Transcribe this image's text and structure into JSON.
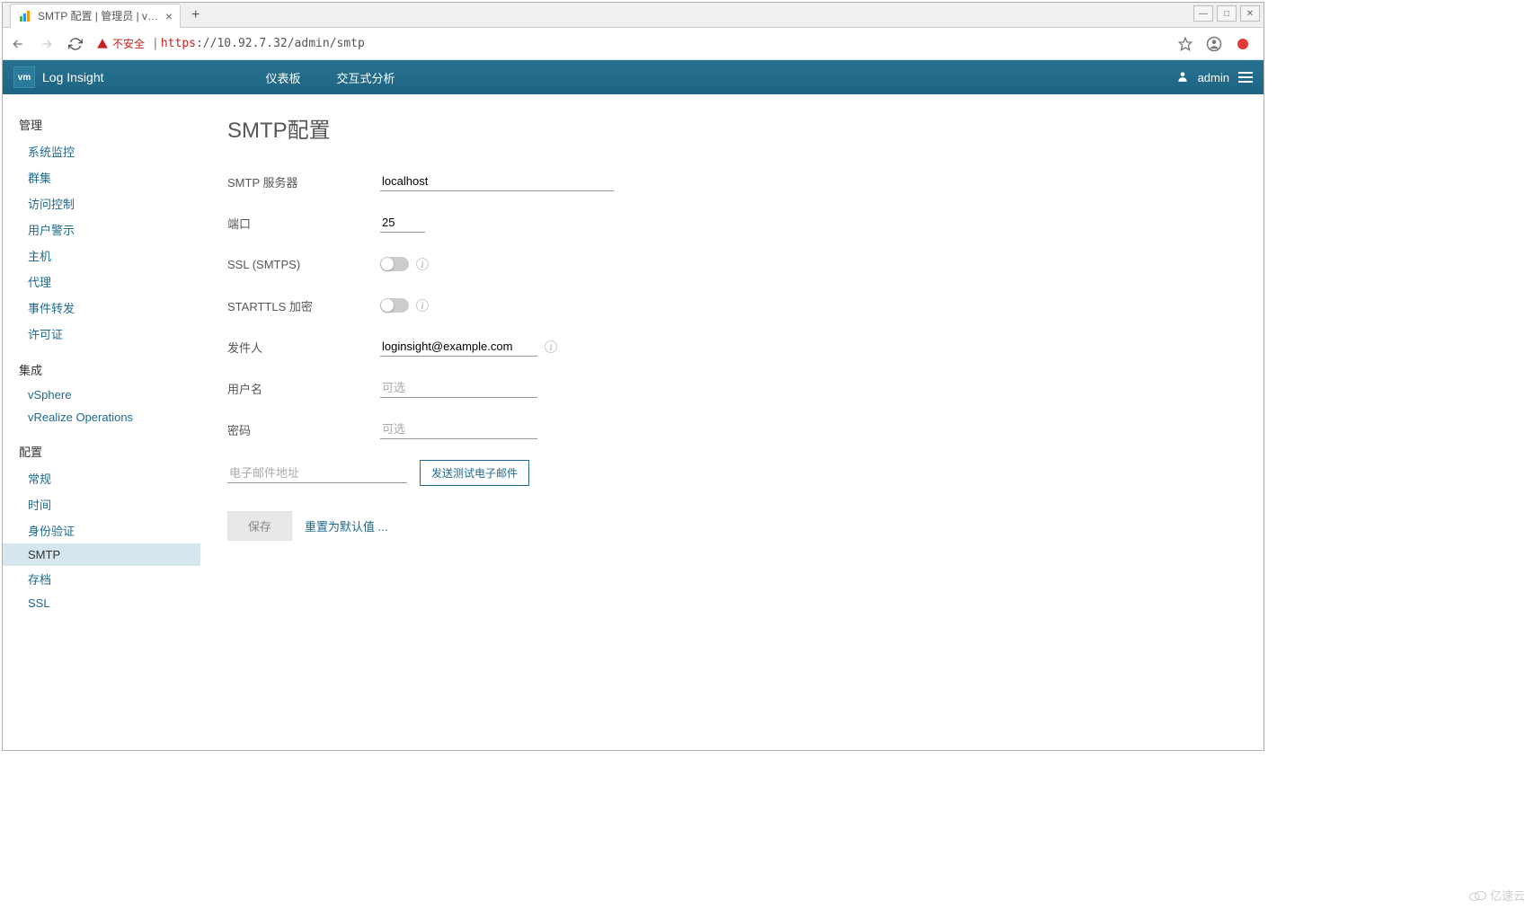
{
  "window": {
    "tab_title": "SMTP 配置 | 管理员 | vRealize",
    "minimize": "—",
    "maximize": "□",
    "close": "✕"
  },
  "browser": {
    "insecure_label": "不安全",
    "url_scheme": "https",
    "url_rest": "://10.92.7.32/admin/smtp"
  },
  "header": {
    "logo": "vm",
    "brand": "Log Insight",
    "nav_dashboard": "仪表板",
    "nav_interactive": "交互式分析",
    "user": "admin"
  },
  "sidebar": {
    "sec_manage": "管理",
    "items_manage": [
      "系统监控",
      "群集",
      "访问控制",
      "用户警示",
      "主机",
      "代理",
      "事件转发",
      "许可证"
    ],
    "sec_integrate": "集成",
    "items_integrate": [
      "vSphere",
      "vRealize Operations"
    ],
    "sec_config": "配置",
    "items_config": [
      "常规",
      "时间",
      "身份验证",
      "SMTP",
      "存档",
      "SSL"
    ],
    "active": "SMTP"
  },
  "content": {
    "title": "SMTP配置",
    "labels": {
      "server": "SMTP 服务器",
      "port": "端口",
      "ssl": "SSL (SMTPS)",
      "starttls": "STARTTLS 加密",
      "sender": "发件人",
      "username": "用户名",
      "password": "密码"
    },
    "values": {
      "server": "localhost",
      "port": "25",
      "sender": "loginsight@example.com"
    },
    "placeholders": {
      "optional": "可选",
      "email": "电子邮件地址"
    },
    "buttons": {
      "send_test": "发送测试电子邮件",
      "save": "保存",
      "reset": "重置为默认值 ..."
    }
  },
  "watermark": "亿速云"
}
